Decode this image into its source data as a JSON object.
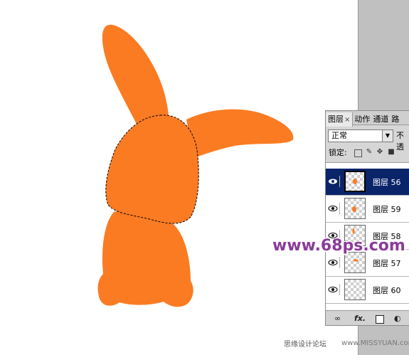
{
  "colors": {
    "shape_fill": "#fb7b22",
    "selected_row": "#0a246a",
    "watermark": "#8b3a9a",
    "workspace": "#c0c0c0"
  },
  "panel": {
    "tabs": [
      {
        "label": "图层",
        "close": "×"
      },
      {
        "label": "动作"
      },
      {
        "label": "通道"
      },
      {
        "label": "路"
      }
    ],
    "blend_mode": "正常",
    "opacity_label": "不透",
    "lock_label": "锁定:",
    "layers": [
      {
        "name": "图层 56",
        "selected": true,
        "visible": true
      },
      {
        "name": "图层 59",
        "selected": false,
        "visible": true
      },
      {
        "name": "图层 58",
        "selected": false,
        "visible": true
      },
      {
        "name": "图层 57",
        "selected": false,
        "visible": true
      },
      {
        "name": "图层 60",
        "selected": false,
        "visible": true
      }
    ],
    "bottom_icons": [
      "link-icon",
      "fx-icon",
      "mask-icon",
      "adjustment-icon",
      "folder-icon"
    ],
    "fx_label": "fx."
  },
  "watermark": "www.68ps.com",
  "footer": "思缘设计论坛",
  "footer_site": "www.MISSYUAN.com"
}
